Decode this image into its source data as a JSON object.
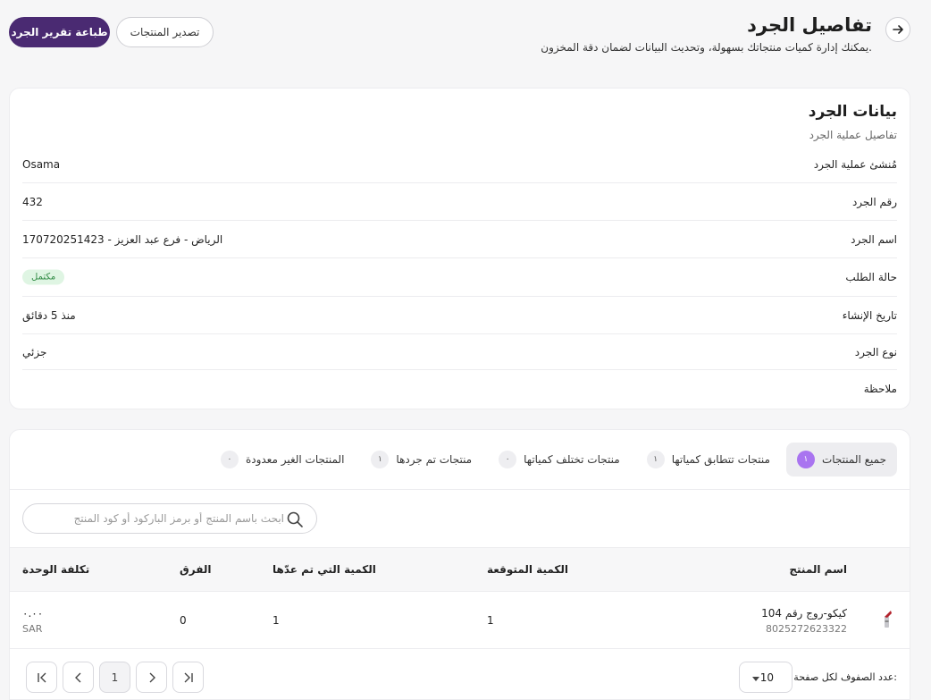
{
  "header": {
    "title": "تفاصيل الجرد",
    "subtitle": "يمكنك إدارة كميات منتجاتك بسهولة، وتحديث البيانات لضمان دقة المخزون.",
    "print_label": "طباعة تقرير الجرد",
    "export_label": "تصدير المنتجات",
    "back_icon": "arrow-right-icon"
  },
  "info": {
    "title": "بيانات الجرد",
    "subtitle": "تفاصيل عملية الجرد",
    "rows": [
      {
        "label": "مُنشئ عملية الجرد",
        "value": "Osama"
      },
      {
        "label": "رقم الجرد",
        "value": "432"
      },
      {
        "label": "اسم الجرد",
        "value": "الرياض - فرع عبد العزيز - 170720251423"
      },
      {
        "label": "حالة الطلب",
        "value": "مكتمل"
      },
      {
        "label": "تاريخ الإنشاء",
        "value": "منذ 5 دقائق"
      },
      {
        "label": "نوع الجرد",
        "value": "جزئي"
      },
      {
        "label": "ملاحظة",
        "value": ""
      }
    ],
    "status_color": "#2f8a43"
  },
  "tabs": [
    {
      "label": "جميع المنتجات",
      "count": "١",
      "active": true
    },
    {
      "label": "منتجات تتطابق كمياتها",
      "count": "١"
    },
    {
      "label": "منتجات تختلف كمياتها",
      "count": "٠"
    },
    {
      "label": "منتجات تم جردها",
      "count": "١"
    },
    {
      "label": "المنتجات الغير معدودة",
      "count": "٠"
    }
  ],
  "search": {
    "placeholder": "ابحث باسم المنتج أو برمز الباركود أو كود المنتج",
    "icon": "search-icon"
  },
  "table": {
    "columns": {
      "product_name": "اسم المنتج",
      "expected_qty": "الكمية المتوقعة",
      "counted_qty": "الكمية التي تم عدّها",
      "difference": "الفرق",
      "unit_cost": "تكلفة الوحدة"
    },
    "rows": [
      {
        "name": "كيكو-روج رقم 104",
        "barcode": "8025272623322",
        "expected": "1",
        "counted": "1",
        "difference": "0",
        "unit_cost": "٠.٠٠",
        "currency": "SAR"
      }
    ]
  },
  "pagination": {
    "rows_per_page_label": "عدد الصفوف لكل صفحة:",
    "rows_per_page": "10",
    "current_page": "1"
  },
  "colors": {
    "accent": "#4a2a72",
    "active_badge": "#a974f0"
  }
}
